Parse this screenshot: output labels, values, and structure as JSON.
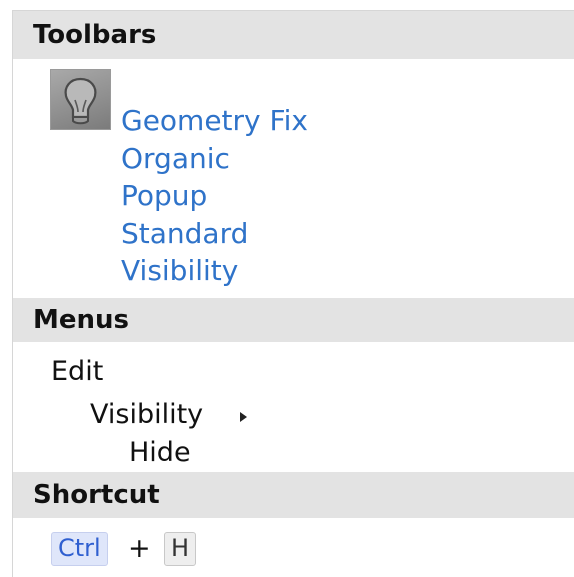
{
  "sections": {
    "toolbars": {
      "title": "Toolbars"
    },
    "menus": {
      "title": "Menus"
    },
    "shortcut": {
      "title": "Shortcut"
    }
  },
  "toolbars": {
    "icon": "lightbulb-icon",
    "items": [
      "Geometry Fix",
      "Organic",
      "Popup",
      "Standard",
      "Visibility"
    ]
  },
  "menus": {
    "path": [
      "Edit",
      "Visibility",
      "Hide"
    ],
    "submenu_indicator": "triangle-right-icon"
  },
  "shortcut": {
    "keys": [
      "Ctrl",
      "H"
    ],
    "separator": "+"
  },
  "colors": {
    "link": "#2f73c9",
    "header_bg": "#e3e3e3",
    "ctrl_key_bg": "#dfe6fa",
    "ctrl_key_text": "#2f5fd0"
  }
}
